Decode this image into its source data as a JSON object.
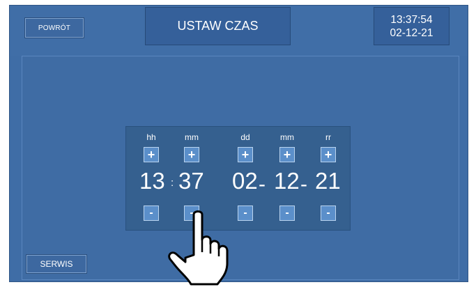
{
  "header": {
    "back_label": "POWRÓT",
    "title": "USTAW CZAS",
    "clock_time": "13:37:54",
    "clock_date": "02-12-21"
  },
  "time_panel": {
    "columns": [
      {
        "label": "hh",
        "value": "13"
      },
      {
        "label": "mm",
        "value": "37"
      },
      {
        "label": "dd",
        "value": "02"
      },
      {
        "label": "mm",
        "value": "12"
      },
      {
        "label": "rr",
        "value": "21"
      }
    ],
    "time_separator": ":",
    "date_separator": "-",
    "plus_label": "+",
    "minus_label": "-"
  },
  "footer": {
    "service_label": "SERWIS"
  },
  "icons": {
    "pointer": "hand-pointer-icon"
  },
  "colors": {
    "background": "#3f6da6",
    "button": "#5b8fca"
  }
}
